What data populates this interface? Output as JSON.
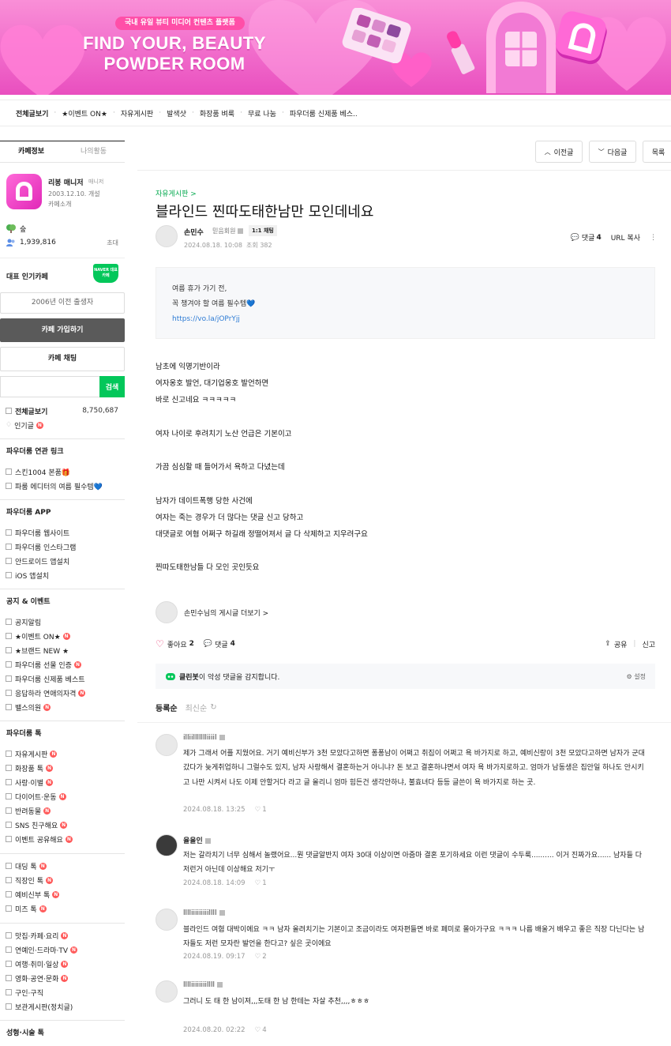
{
  "banner": {
    "badge": "국내 유일 뷰티 미디어 컨텐츠 플랫폼",
    "title_line1": "FIND YOUR, BEAUTY",
    "title_line2": "POWDER ROOM"
  },
  "nav": {
    "items": [
      "전체글보기",
      "★이벤트 ON★",
      "자유게시판",
      "발색샷",
      "화장품 벼룩",
      "무료 나눔",
      "파우더룸 신제품 베스.."
    ]
  },
  "sidebar": {
    "tabs": [
      "카페정보",
      "나의활동"
    ],
    "manager_name": "리봉 매니저",
    "manager_role": "매니저",
    "cafe_date": "2003.12.10. 개설",
    "cafe_intro": "카페소개",
    "level": "숲",
    "members": "1,939,816",
    "invite": "초대",
    "popular_label": "대표 인기카페",
    "naver_badge": "NAVER 대표카페",
    "age_btn": "2006년 이전 출생자",
    "join_btn": "카페 가입하기",
    "chat_btn": "카페 채팅",
    "search_btn": "검색",
    "all_posts": "전체글보기",
    "all_posts_count": "8,750,687",
    "popular_posts": "인기글",
    "sections": [
      {
        "title": "파우더룸 연관 링크",
        "items": [
          {
            "label": "스킨1004 본품🎁",
            "new": false
          },
          {
            "label": "파룸 에디터의 여름 필수템💙",
            "new": false
          }
        ]
      },
      {
        "title": "파우더룸 APP",
        "items": [
          {
            "label": "파우더룸 웹사이트",
            "new": false
          },
          {
            "label": "파우더룸 인스타그램",
            "new": false
          },
          {
            "label": "안드로이드 앱설치",
            "new": false
          },
          {
            "label": "iOS 앱설치",
            "new": false
          }
        ]
      },
      {
        "title": "공지 & 이벤트",
        "items": [
          {
            "label": "공지알림",
            "new": false
          },
          {
            "label": "★이벤트 ON★",
            "new": true
          },
          {
            "label": "★브랜드 NEW ★",
            "new": false
          },
          {
            "label": "파우더룸 선물 인증",
            "new": true
          },
          {
            "label": "파우더룸 신제품 베스트",
            "new": false
          },
          {
            "label": "응답하라 연애의자격",
            "new": true
          },
          {
            "label": "밸스의원",
            "new": true
          }
        ]
      },
      {
        "title": "파우더룸 톡",
        "items": [
          {
            "label": "자유게시판",
            "new": true
          },
          {
            "label": "화장품 톡",
            "new": true
          },
          {
            "label": "사랑·이별",
            "new": true
          },
          {
            "label": "다이어트·운동",
            "new": true
          },
          {
            "label": "반려동물",
            "new": true
          },
          {
            "label": "SNS 친구해요",
            "new": true
          },
          {
            "label": "이벤트 공유해요",
            "new": true
          }
        ]
      },
      {
        "title": "",
        "items": [
          {
            "label": "대딩 톡",
            "new": true
          },
          {
            "label": "직장인 톡",
            "new": true
          },
          {
            "label": "예비신부 톡",
            "new": true
          },
          {
            "label": "미즈 톡",
            "new": true
          }
        ]
      },
      {
        "title": "",
        "items": [
          {
            "label": "맛집·카페·요리",
            "new": true
          },
          {
            "label": "연예인·드라마·TV",
            "new": true
          },
          {
            "label": "여행·취미·일상",
            "new": true
          },
          {
            "label": "영화·공연·문화",
            "new": true
          },
          {
            "label": "구인·구직",
            "new": false
          },
          {
            "label": "보관게시판(정치글)",
            "new": false
          }
        ]
      }
    ],
    "last_head": "성형·시술 톡"
  },
  "top_buttons": {
    "prev": "이전글",
    "next": "다음글",
    "list": "목록"
  },
  "article": {
    "board": "자유게시판 >",
    "title": "블라인드 찐따도태한남만 모인데네요",
    "author": "손민수",
    "grade": "믿음회원",
    "chat_tag": "1:1 채팅",
    "date": "2024.08.18. 10:08",
    "views_label": "조회",
    "views": "382",
    "comment_label": "댓글",
    "comment_count": "4",
    "url_copy": "URL 복사",
    "notice_line1": "여름 휴가 가기 전,",
    "notice_line2": "꼭 챙겨야 할 여름 필수템💙",
    "notice_link": "https://vo.la/jOPrYjj",
    "body": "남초에 익명기반이라\n여자옹호 발언, 대기업옹호 발언하면\n바로 신고네요 ㅋㅋㅋㅋㅋ\n\n여자 나이로 후려치기 노산 언급은 기본이고\n\n가끔 심심할 때 들어가서 욕하고 다녔는데\n\n남자가 데이트폭행 당한 사건에\n여자는 죽는 경우가 더 많다는 댓글 신고 당하고\n대댓글로 여혐 어쩌구 하길래 정떨어져서 글 다 삭제하고 지우려구요\n\n찐따도태한남들 다 모인 곳인듯요",
    "more_author": "손민수님의 게시글 더보기 >",
    "like_label": "좋아요",
    "like_count": "2",
    "share": "공유",
    "report": "신고",
    "cleanbot_name": "클린봇",
    "cleanbot_text": "이 악성 댓글을 감지합니다.",
    "cleanbot_setting": "설정",
    "sort_reg": "등록순",
    "sort_new": "최신순"
  },
  "comments": [
    {
      "author": "illiillllllliiiil",
      "text": "제가 그래서 어플 지웠어요. 거기 예비신부가 3천 모았다고하면 퐁퐁남이 어쩌고 취집이 어쩌고 욕 바가지로 하고, 예비신랑이 3천 모았다고하면 남자가 군대 갔다가 늦게취업하니 그럴수도 있지, 남자 사랑해서 결혼하는거 아니냐? 돈 보고 결혼하냐면서 여자 욕 바가지로하고. 엄마가 남동생은 집안일 하나도 안시키고 나만 시켜서 나도 이제 안할거다 라고 글 올리니 엄마 힘든건 생각안하냐, 불효녀다 등등 글쓴이 욕 바가지로 하는 곳.",
      "date": "2024.08.18. 13:25",
      "likes": "1"
    },
    {
      "author": "율율인",
      "text": "저는 갈라치기 너무 심해서 놀랬어요...뭔 댓글알반지 여자 30대 이상이면 아줌마 결혼 포기하세요 이런 댓글이 수두룩.......... 이거 진짜가요...... 남자들 다 저런거 아닌데 이상해요 저기ㅜ",
      "date": "2024.08.18. 14:09",
      "likes": "1"
    },
    {
      "author": "lllliiiiiiiiillll",
      "text": "블라인드 여혐 대박이에요 ㅋㅋ 남자 올려치기는 기본이고 조금이라도 여자편들면 바로 페미로 몰아가구요 ㅋㅋㅋ 나름 배울거 배우고 좋은 직장 다닌다는 남자들도 저런 모자란 발언을 한다고? 싶은 곳이에요",
      "date": "2024.08.19. 09:17",
      "likes": "2"
    },
    {
      "author": "lllliiiiiiiillll",
      "text": "그러니 도 태 한 남이져,,,도태 한 남 한테는 자살 추천,,,,ㅎㅎㅎ",
      "date": "2024.08.20. 02:22",
      "likes": "4"
    }
  ],
  "colors": {
    "accent": "#03c75a",
    "banner_pink": "#f16ccb",
    "new_badge": "#ff5a5a"
  }
}
